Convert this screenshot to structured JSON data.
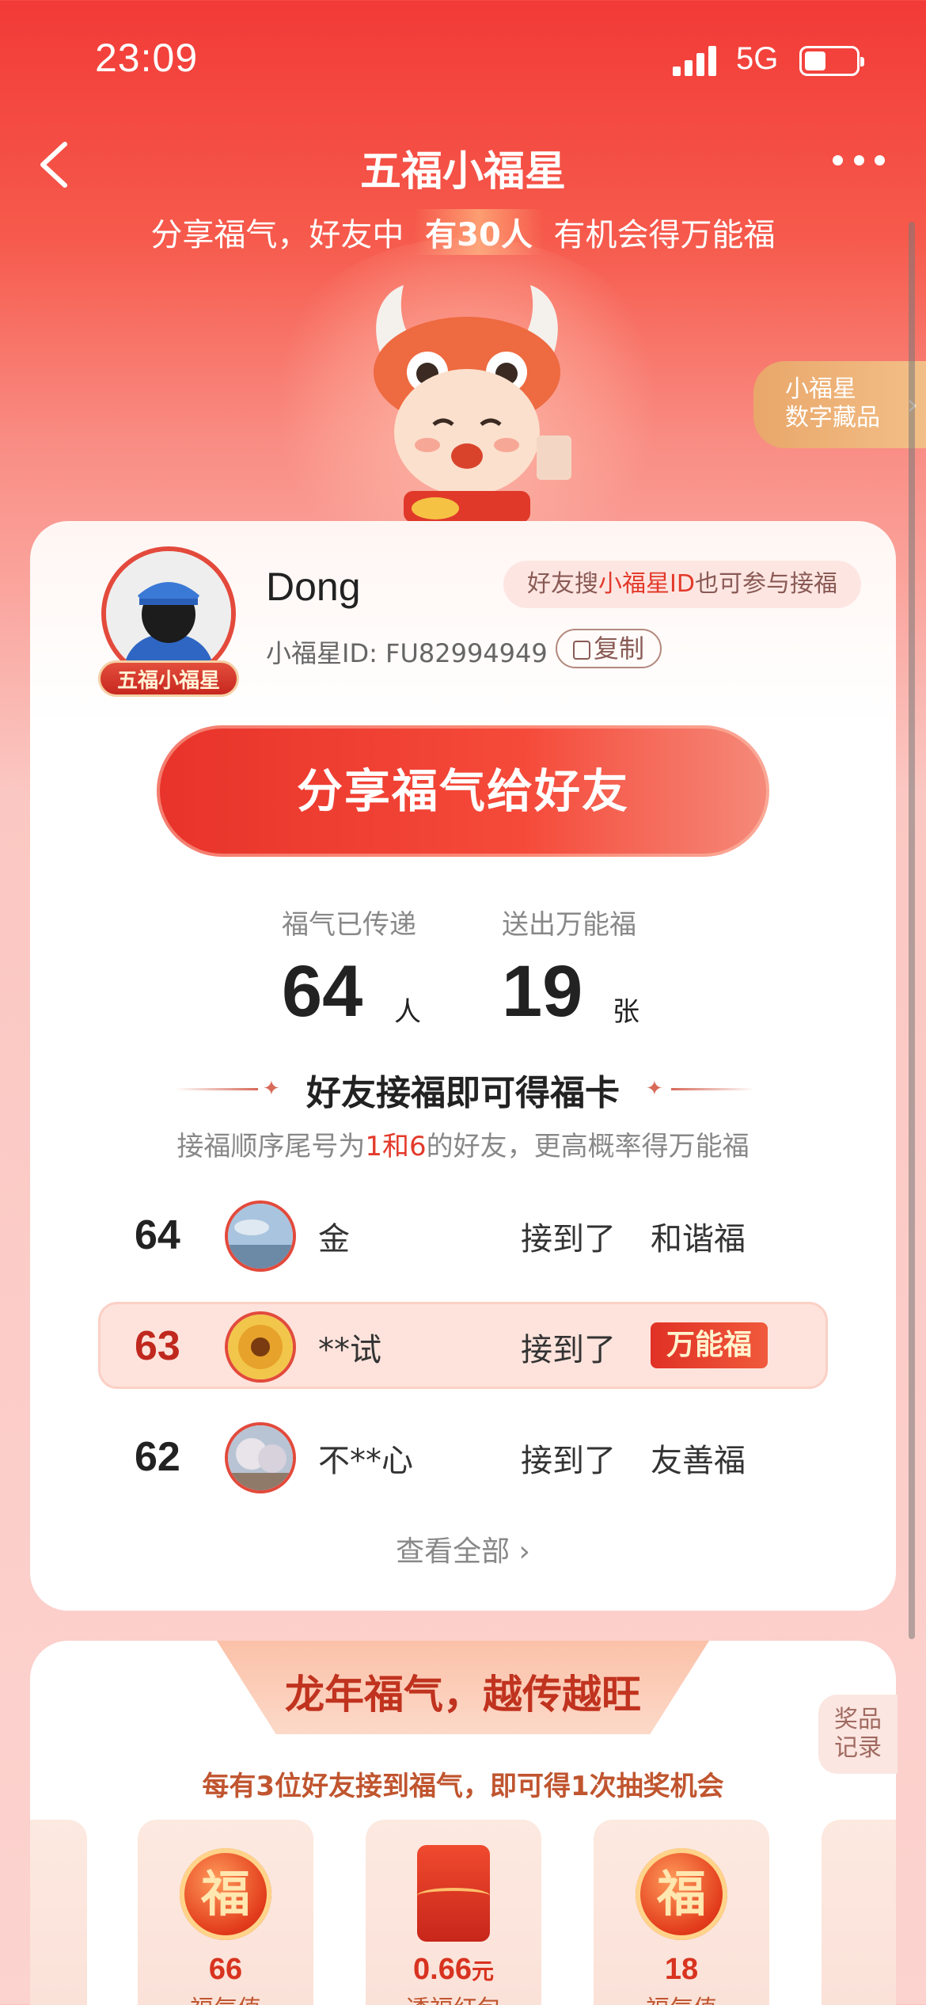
{
  "status_bar": {
    "time": "23:09",
    "network": "5G"
  },
  "nav": {
    "title": "五福小福星"
  },
  "subtitle": {
    "prefix": "分享福气，好友中 ",
    "highlight": "有30人",
    "suffix": " 有机会得万能福"
  },
  "nft_tag": {
    "line1": "小福星",
    "line2": "数字藏品"
  },
  "profile": {
    "name": "Dong",
    "badge": "五福小福星",
    "tip_prefix": "好友搜",
    "tip_highlight": "小福星ID",
    "tip_suffix": "也可参与接福",
    "uid": "小福星ID: FU82994949",
    "copy_label": "复制"
  },
  "share_button": "分享福气给好友",
  "stats": {
    "passed": {
      "label": "福气已传递",
      "value": "64",
      "unit": "人"
    },
    "given": {
      "label": "送出万能福",
      "value": "19",
      "unit": "张"
    }
  },
  "section": {
    "title": "好友接福即可得福卡",
    "sub_prefix": "接福顺序尾号为",
    "sub_highlight": "1和6",
    "sub_suffix": "的好友，更高概率得万能福"
  },
  "receivers": [
    {
      "rank": "64",
      "name": "金",
      "action": "接到了",
      "card": "和谐福"
    },
    {
      "rank": "63",
      "name": "**试",
      "action": "接到了",
      "card": "万能福"
    },
    {
      "rank": "62",
      "name": "不**心",
      "action": "接到了",
      "card": "友善福"
    }
  ],
  "see_all": "查看全部",
  "lottery": {
    "banner": "龙年福气，越传越旺",
    "record_line1": "奖品",
    "record_line2": "记录",
    "subtitle": "每有3位好友接到福气，即可得1次抽奖机会",
    "prizes": [
      {
        "value": "66",
        "unit": "",
        "label": "福气值",
        "icon": "fu-coin-icon"
      },
      {
        "value": "0.66",
        "unit": "元",
        "label": "透福红包",
        "icon": "red-packet-icon"
      },
      {
        "value": "18",
        "unit": "",
        "label": "福气值",
        "icon": "fu-coin-icon"
      }
    ],
    "fu_glyph": "福"
  },
  "colors": {
    "primary_red": "#e8332a",
    "highlight_red": "#e33a2b",
    "wan_card": "#e03125"
  }
}
